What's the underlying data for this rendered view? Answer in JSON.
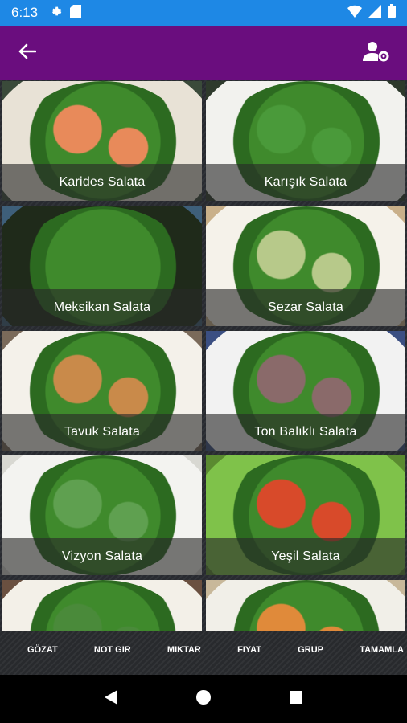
{
  "status_bar": {
    "time": "6:13"
  },
  "app_bar": {
    "back_icon": "arrow-left-icon",
    "settings_icon": "user-settings-icon"
  },
  "salads": [
    {
      "label": "Karides Salata",
      "bg": "#3a4a3a",
      "plate": "#e8e2d6",
      "food": "#e88a5a"
    },
    {
      "label": "Karışık Salata",
      "bg": "#2e3a2c",
      "plate": "#f2f2ee",
      "food": "#4a9a3a"
    },
    {
      "label": "Meksikan Salata",
      "bg": "#3e5f7a",
      "plate": "#1f2a1a",
      "food": "#3f8a2c"
    },
    {
      "label": "Sezar Salata",
      "bg": "#c9b08a",
      "plate": "#f5f2ea",
      "food": "#b7c98a"
    },
    {
      "label": "Tavuk Salata",
      "bg": "#7a6a5a",
      "plate": "#f4f1ea",
      "food": "#c98a4a"
    },
    {
      "label": "Ton Balıklı Salata",
      "bg": "#3b4f82",
      "plate": "#f2f2f2",
      "food": "#8a6a6a"
    },
    {
      "label": "Vizyon Salata",
      "bg": "#d8d8d2",
      "plate": "#f3f3f0",
      "food": "#5fa050"
    },
    {
      "label": "Yeşil Salata",
      "bg": "#5a8a30",
      "plate": "#7fc24a",
      "food": "#d84a2a"
    },
    {
      "label": "",
      "bg": "#6a5040",
      "plate": "#f3f0e8",
      "food": "#4a8a3a"
    },
    {
      "label": "",
      "bg": "#c8b89a",
      "plate": "#f1efe8",
      "food": "#e08a3a"
    }
  ],
  "bottom_bar": {
    "buttons": [
      "GÖZAT",
      "NOT GIR",
      "MIKTAR",
      "FIYAT",
      "GRUP",
      "TAMAMLA"
    ]
  }
}
